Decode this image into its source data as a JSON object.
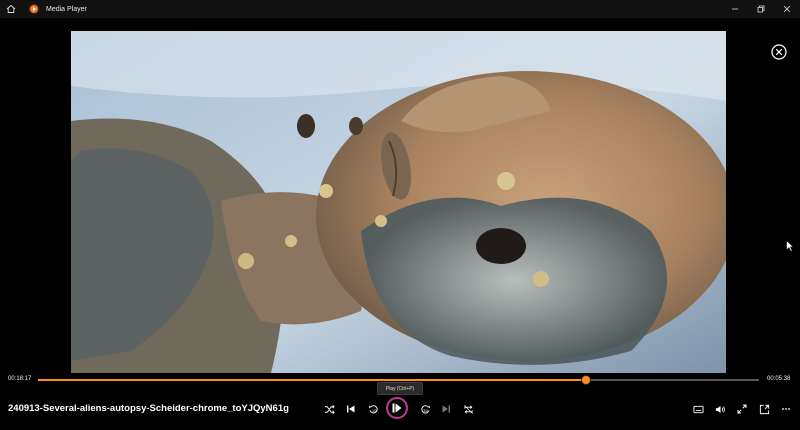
{
  "window": {
    "title": "Media Player",
    "buttons": [
      "minimize",
      "restore",
      "close"
    ]
  },
  "player": {
    "current_time": "00:18:17",
    "total_time": "00:05:38",
    "progress": 0.76,
    "tooltip": "Play (Ctrl+P)",
    "filename": "240913-Several-aliens-autopsy-Scheider-chrome_toYJQyN61g"
  },
  "icons": {
    "home": "home-icon",
    "app": "media-player-icon",
    "overlay_close": "close-circle-icon",
    "shuffle": "shuffle-icon",
    "previous": "previous-icon",
    "rewind": "rewind-10-icon",
    "play": "play-icon",
    "forward": "forward-30-icon",
    "next": "next-icon",
    "repeat": "repeat-off-icon",
    "subtitles": "subtitles-icon",
    "volume": "volume-icon",
    "fullscreen": "fullscreen-icon",
    "miniplayer": "miniplayer-icon",
    "more": "more-icon"
  },
  "colors": {
    "accent": "#ff8c1f",
    "play_ring": "#c0399a",
    "titlebar": "#111111"
  }
}
